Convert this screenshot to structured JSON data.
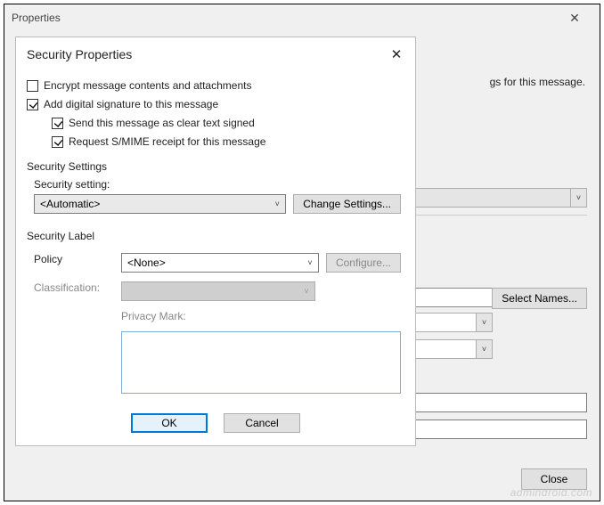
{
  "properties_window": {
    "title": "Properties",
    "hint_fragment": "gs for this message.",
    "select_names_btn": "Select Names...",
    "close_btn": "Close"
  },
  "security_dialog": {
    "title": "Security Properties",
    "encrypt": {
      "checked": false,
      "label": "Encrypt message contents and attachments"
    },
    "sign": {
      "checked": true,
      "label": "Add digital signature to this message"
    },
    "clear": {
      "checked": true,
      "label": "Send this message as clear text signed"
    },
    "receipt": {
      "checked": true,
      "label": "Request S/MIME receipt for this message"
    },
    "settings_group": {
      "legend": "Security Settings",
      "setting_label": "Security setting:",
      "setting_value": "<Automatic>",
      "change_btn": "Change Settings..."
    },
    "label_group": {
      "legend": "Security Label",
      "policy_label": "Policy",
      "policy_value": "<None>",
      "configure_btn": "Configure...",
      "classification_label": "Classification:",
      "privacy_label": "Privacy Mark:"
    },
    "ok_btn": "OK",
    "cancel_btn": "Cancel"
  },
  "watermark": "admindroid.com"
}
